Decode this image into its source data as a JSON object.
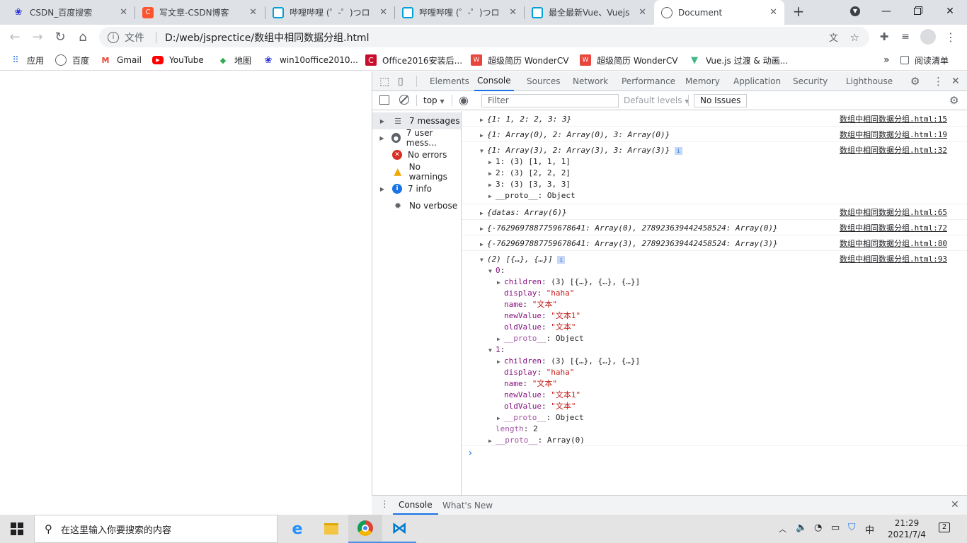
{
  "browser": {
    "tabs": [
      {
        "title": "CSDN_百度搜索",
        "icon": "baidu-paw-icon",
        "color": "#2932e1"
      },
      {
        "title": "写文章-CSDN博客",
        "icon": "csdn-c-icon",
        "color": "#fc5531"
      },
      {
        "title": "哔哩哔哩 (゜-゜)つロ",
        "icon": "bilibili-tv-icon",
        "color": "#00a1d6"
      },
      {
        "title": "哔哩哔哩 (゜-゜)つロ",
        "icon": "bilibili-tv-icon",
        "color": "#00a1d6"
      },
      {
        "title": "最全最新Vue、Vuejs",
        "icon": "bilibili-tv-icon",
        "color": "#00a1d6"
      },
      {
        "title": "Document",
        "icon": "globe-icon",
        "color": "#5f6368"
      }
    ],
    "address": {
      "scheme_label": "文件",
      "url": "D:/web/jsprectice/数组中相同数据分组.html"
    },
    "bookmarks": [
      {
        "label": "应用",
        "icon": "apps-grid-icon"
      },
      {
        "label": "百度",
        "icon": "globe-icon"
      },
      {
        "label": "Gmail",
        "icon": "gmail-icon"
      },
      {
        "label": "YouTube",
        "icon": "youtube-icon"
      },
      {
        "label": "地图",
        "icon": "maps-icon"
      },
      {
        "label": "win10office2010...",
        "icon": "baidu-paw-icon"
      },
      {
        "label": "Office2016安装后...",
        "icon": "csdn-c-icon"
      },
      {
        "label": "超级简历 WonderCV",
        "icon": "wondercv-icon"
      },
      {
        "label": "超级简历 WonderCV",
        "icon": "wondercv-icon"
      },
      {
        "label": "Vue.js 过渡 & 动画...",
        "icon": "vue-icon"
      }
    ],
    "more_bookmarks": "»",
    "reading_list": "阅读清单"
  },
  "devtools": {
    "tabs": [
      "Elements",
      "Console",
      "Sources",
      "Network",
      "Performance",
      "Memory",
      "Application",
      "Security",
      "Lighthouse"
    ],
    "active_tab": "Console",
    "console_toolbar": {
      "context": "top",
      "filter_placeholder": "Filter",
      "levels": "Default levels",
      "issues": "No Issues"
    },
    "sidebar": [
      {
        "label": "7 messages",
        "icon": "list-icon",
        "expandable": true
      },
      {
        "label": "7 user mess...",
        "icon": "user-icon",
        "expandable": true
      },
      {
        "label": "No errors",
        "icon": "error-icon",
        "expandable": false
      },
      {
        "label": "No warnings",
        "icon": "warning-icon",
        "expandable": false
      },
      {
        "label": "7 info",
        "icon": "info-icon",
        "expandable": true
      },
      {
        "label": "No verbose",
        "icon": "bug-icon",
        "expandable": false
      }
    ],
    "messages": [
      {
        "text": "{1: 1, 2: 2, 3: 3}",
        "source": "数组中相同数据分组.html:15"
      },
      {
        "text": "{1: Array(0), 2: Array(0), 3: Array(0)}",
        "source": "数组中相同数据分组.html:19"
      },
      {
        "text": "{1: Array(3), 2: Array(3), 3: Array(3)}",
        "source": "数组中相同数据分组.html:32",
        "children": [
          "1: (3) [1, 1, 1]",
          "2: (3) [2, 2, 2]",
          "3: (3) [3, 3, 3]",
          "__proto__: Object"
        ]
      },
      {
        "text": "{datas: Array(6)}",
        "source": "数组中相同数据分组.html:65"
      },
      {
        "text": "{-7629697887759678641: Array(0), 278923639442458524: Array(0)}",
        "source": "数组中相同数据分组.html:72"
      },
      {
        "text": "{-7629697887759678641: Array(3), 278923639442458524: Array(3)}",
        "source": "数组中相同数据分组.html:80"
      },
      {
        "text": "(2) [{…}, {…}]",
        "source": "数组中相同数据分组.html:93",
        "lines": [
          {
            "key": "0",
            "value": ""
          },
          {
            "key": "children",
            "value": "(3) [{…}, {…}, {…}]"
          },
          {
            "key": "display",
            "value": "\"haha\""
          },
          {
            "key": "name",
            "value": "\"文本\""
          },
          {
            "key": "newValue",
            "value": "\"文本1\""
          },
          {
            "key": "oldValue",
            "value": "\"文本\""
          },
          {
            "key": "__proto__",
            "value": "Object"
          },
          {
            "key": "1",
            "value": ""
          },
          {
            "key": "children",
            "value": "(3) [{…}, {…}, {…}]"
          },
          {
            "key": "display",
            "value": "\"haha\""
          },
          {
            "key": "name",
            "value": "\"文本\""
          },
          {
            "key": "newValue",
            "value": "\"文本1\""
          },
          {
            "key": "oldValue",
            "value": "\"文本\""
          },
          {
            "key": "__proto__",
            "value": "Object"
          },
          {
            "key": "length",
            "value": "2"
          },
          {
            "key": "__proto__",
            "value": "Array(0)"
          }
        ]
      }
    ],
    "prompt": "›",
    "drawer_tabs": [
      "Console",
      "What's New"
    ]
  },
  "taskbar": {
    "search_placeholder": "在这里输入你要搜索的内容",
    "ime": "中",
    "time": "21:29",
    "date": "2021/7/4",
    "notifications": "2"
  },
  "colors": {
    "accent": "#1a73e8",
    "key": "#881280",
    "string": "#c41a16",
    "number": "#1a1aa6"
  }
}
